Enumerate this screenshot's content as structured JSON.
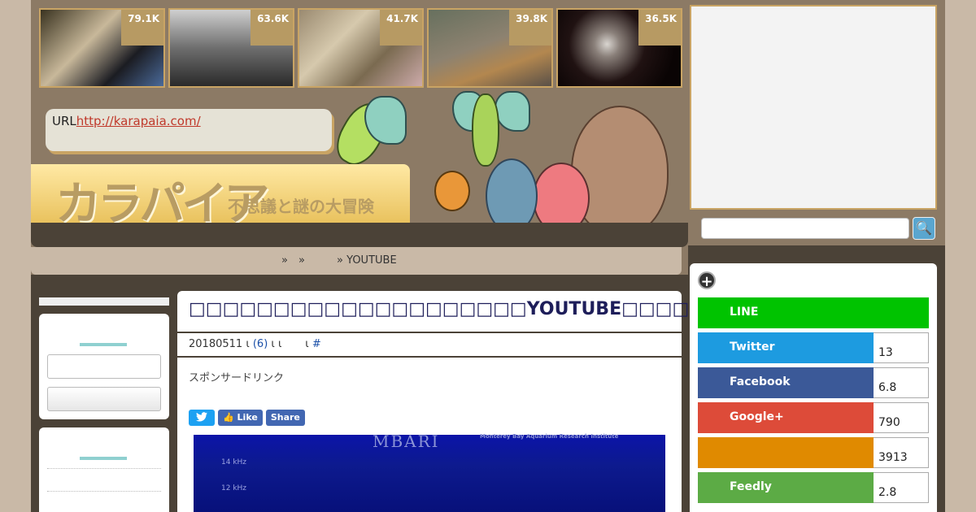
{
  "thumbnails": [
    {
      "count": "79.1K"
    },
    {
      "count": "63.6K"
    },
    {
      "count": "41.7K"
    },
    {
      "count": "39.8K"
    },
    {
      "count": "36.5K"
    }
  ],
  "url_bubble": {
    "prefix": "URL",
    "link": "http://karapaia.com/"
  },
  "logo": {
    "main": "カラパイア",
    "sub": "不思議と謎の大冒険"
  },
  "breadcrumb": {
    "sep1": "»",
    "sep2": "»",
    "last": "» YOUTUBE"
  },
  "article": {
    "title": "□□□□□□□□□□□□□□□□□□□□YOUTUBE□□□□□□□□",
    "meta_date": "20180511",
    "meta_sep": "ι",
    "meta_comments": "(6)",
    "meta_rest": "ι ι",
    "meta_tag_prefix": "ι",
    "meta_tag": "#",
    "sponsor": "スポンサードリンク",
    "share": {
      "like": "Like",
      "share": "Share"
    },
    "video": {
      "brand": "MBARI",
      "brand_sub": "Monterey Bay Aquarium Research Institute",
      "tick1": "14 kHz",
      "tick2": "12 kHz"
    }
  },
  "share_panel": {
    "rows": [
      {
        "label": "LINE",
        "count": "",
        "color": "#00c300"
      },
      {
        "label": "Twitter",
        "count": "13",
        "color": "#1d9be0"
      },
      {
        "label": "Facebook",
        "count": "6.8",
        "color": "#3b5998"
      },
      {
        "label": "Google+",
        "count": "790",
        "color": "#dd4b39"
      },
      {
        "label": "",
        "count": "3913",
        "color": "#e08a00"
      },
      {
        "label": "Feedly",
        "count": "2.8",
        "color": "#5cab45"
      }
    ]
  },
  "search_button": "🔍"
}
